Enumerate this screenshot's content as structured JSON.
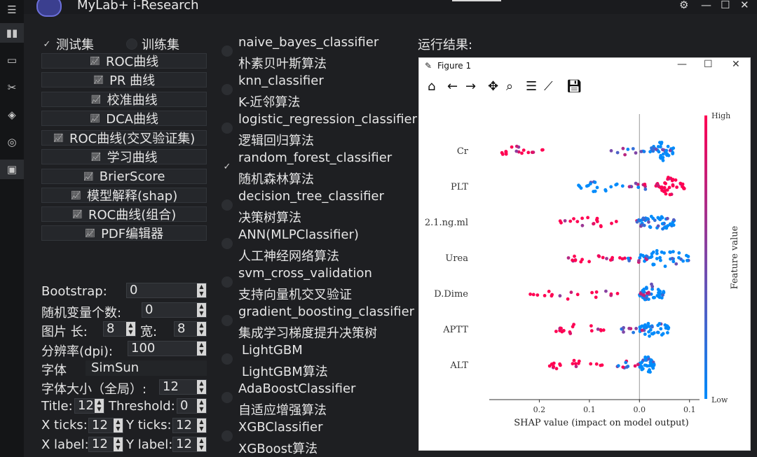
{
  "app": {
    "title": "MyLab+ i-Research"
  },
  "dataset": {
    "test_label": "测试集",
    "train_label": "训练集",
    "test_checked": true,
    "train_checked": false
  },
  "buttons": [
    "ROC曲线",
    "PR 曲线",
    "校准曲线",
    "DCA曲线",
    "ROC曲线(交叉验证集)",
    "学习曲线",
    "BrierScore",
    "模型解释(shap)",
    "ROC曲线(组合)",
    "PDF编辑器"
  ],
  "params": {
    "bootstrap_label": "Bootstrap:",
    "bootstrap_value": "0",
    "rand_label": "随机变量个数:",
    "rand_value": "0",
    "img_len_label": "图片 长:",
    "img_len_value": "8",
    "img_wid_label": "宽:",
    "img_wid_value": "8",
    "dpi_label": "分辨率(dpi):",
    "dpi_value": "100",
    "font_label": "字体",
    "font_value": "SimSun",
    "fontsize_label": "字体大小（全局）:",
    "fontsize_value": "12",
    "title_label": "Title:",
    "title_value": "12",
    "threshold_label": "Threshold:",
    "threshold_value": "0",
    "xticks_label": "X ticks:",
    "xticks_value": "12",
    "yticks_label": "Y ticks:",
    "yticks_value": "12",
    "xlabel_label": "X label:",
    "xlabel_value": "12",
    "ylabel_label": "Y label:",
    "ylabel_value": "12"
  },
  "algorithms": [
    {
      "name": "naive_bayes_classifier",
      "desc": "朴素贝叶斯算法",
      "checked": false
    },
    {
      "name": "knn_classifier",
      "desc": "K-近邻算法",
      "checked": false
    },
    {
      "name": "logistic_regression_classifier",
      "desc": "逻辑回归算法",
      "checked": false
    },
    {
      "name": "random_forest_classifier",
      "desc": "随机森林算法",
      "checked": true
    },
    {
      "name": "decision_tree_classifier",
      "desc": "决策树算法",
      "checked": false
    },
    {
      "name": "ANN(MLPClassifier)",
      "desc": "人工神经网络算法",
      "checked": false
    },
    {
      "name": "svm_cross_validation",
      "desc": "支持向量机交叉验证",
      "checked": false
    },
    {
      "name": "gradient_boosting_classifier",
      "desc": "集成学习梯度提升决策树",
      "checked": false
    },
    {
      "name": "LightGBM",
      "desc": "LightGBM算法",
      "checked": false
    },
    {
      "name": "AdaBoostClassifier",
      "desc": "自适应增强算法",
      "checked": false
    },
    {
      "name": "XGBClassifier",
      "desc": "XGBoost算法",
      "checked": false
    }
  ],
  "result_label": "运行结果:",
  "figure": {
    "title": "Figure 1"
  },
  "chart_data": {
    "type": "scatter",
    "subtype": "shap_beeswarm",
    "features": [
      "Cr",
      "PLT",
      "2.1.ng.ml",
      "Urea",
      "D.Dime",
      "APTT",
      "ALT"
    ],
    "xlabel": "SHAP value (impact on model output)",
    "x_ticks": [
      "0.2",
      "0.1",
      "0.0",
      "0.1"
    ],
    "x_tick_values": [
      -0.2,
      -0.1,
      0.0,
      0.1
    ],
    "xlim": [
      -0.3,
      0.12
    ],
    "colorbar": {
      "label": "Feature value",
      "high": "High",
      "low": "Low",
      "high_color": "#ff0052",
      "low_color": "#008bfb"
    },
    "clusters": [
      {
        "feature": "Cr",
        "neg": [
          -0.29,
          -0.19
        ],
        "neg_color": "high",
        "pos": [
          0.02,
          0.07
        ],
        "pos_color": "low",
        "mid": [
          -0.06,
          0.01
        ]
      },
      {
        "feature": "PLT",
        "neg": [
          -0.13,
          -0.03
        ],
        "neg_color": "low",
        "pos": [
          0.03,
          0.09
        ],
        "pos_color": "high",
        "mid": [
          -0.02,
          0.02
        ]
      },
      {
        "feature": "2.1.ng.ml",
        "neg": [
          -0.16,
          -0.04
        ],
        "neg_color": "high",
        "pos": [
          0.0,
          0.07
        ],
        "pos_color": "low",
        "mid": [
          -0.01,
          0.02
        ]
      },
      {
        "feature": "Urea",
        "neg": [
          -0.15,
          -0.03
        ],
        "neg_color": "high",
        "pos": [
          0.0,
          0.1
        ],
        "pos_color": "low",
        "mid": [
          -0.03,
          0.02
        ]
      },
      {
        "feature": "D.Dime",
        "neg": [
          -0.22,
          -0.04
        ],
        "neg_color": "high",
        "pos": [
          0.0,
          0.05
        ],
        "pos_color": "low",
        "mid": [
          0.0,
          0.02
        ]
      },
      {
        "feature": "APTT",
        "neg": [
          -0.17,
          -0.07
        ],
        "neg_color": "high",
        "pos": [
          0.0,
          0.06
        ],
        "pos_color": "low",
        "mid": [
          -0.04,
          0.01
        ]
      },
      {
        "feature": "ALT",
        "neg": [
          -0.19,
          -0.07
        ],
        "neg_color": "high",
        "pos": [
          0.0,
          0.03
        ],
        "pos_color": "low",
        "mid": [
          -0.05,
          0.0
        ]
      }
    ]
  }
}
